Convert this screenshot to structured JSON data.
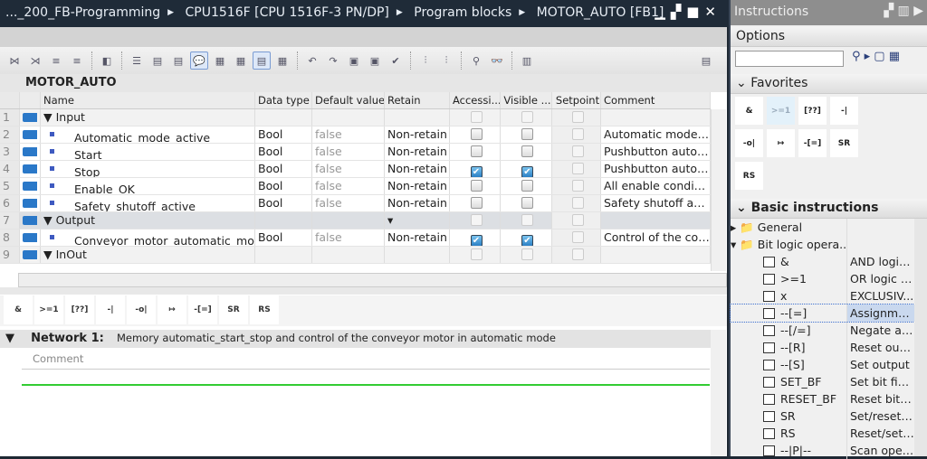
{
  "breadcrumb": [
    "..._200_FB-Programming",
    "CPU1516F [CPU 1516F-3 PN/DP]",
    "Program blocks",
    "MOTOR_AUTO [FB1]"
  ],
  "block_title": "MOTOR_AUTO",
  "columns": [
    "",
    "",
    "Name",
    "Data type",
    "Default value",
    "Retain",
    "Accessi...",
    "Visible ...",
    "Setpoint",
    "Comment"
  ],
  "rows": [
    {
      "n": "1",
      "name": "Input",
      "group": true,
      "type": "",
      "def": "",
      "retain": "",
      "acc": null,
      "vis": null,
      "comment": ""
    },
    {
      "n": "2",
      "name": "Automatic_mode_active",
      "type": "Bool",
      "def": "false",
      "retain": "Non-retain",
      "acc": false,
      "vis": false,
      "comment": "Automatic mode a..."
    },
    {
      "n": "3",
      "name": "Start",
      "type": "Bool",
      "def": "false",
      "retain": "Non-retain",
      "acc": false,
      "vis": false,
      "comment": "Pushbutton autom..."
    },
    {
      "n": "4",
      "name": "Stop",
      "type": "Bool",
      "def": "false",
      "retain": "Non-retain",
      "acc": true,
      "vis": true,
      "comment": "Pushbutton autom..."
    },
    {
      "n": "5",
      "name": "Enable_OK",
      "type": "Bool",
      "def": "false",
      "retain": "Non-retain",
      "acc": false,
      "vis": false,
      "comment": "All enable conditio..."
    },
    {
      "n": "6",
      "name": "Safety_shutoff_active",
      "type": "Bool",
      "def": "false",
      "retain": "Non-retain",
      "acc": false,
      "vis": false,
      "comment": "Safety shutoff activ..."
    },
    {
      "n": "7",
      "name": "Output",
      "group": true,
      "selected": true,
      "type": "",
      "def": "",
      "retain": "",
      "acc": null,
      "vis": null,
      "comment": ""
    },
    {
      "n": "8",
      "name": "Conveyor_motor_automatic_mode",
      "type": "Bool",
      "def": "false",
      "retain": "Non-retain",
      "acc": true,
      "vis": true,
      "comment": "Control of the conv..."
    },
    {
      "n": "9",
      "name": "InOut",
      "group": true,
      "type": "",
      "def": "",
      "retain": "",
      "acc": null,
      "vis": null,
      "comment": ""
    }
  ],
  "favorites": [
    "&",
    ">=1",
    "[??]",
    "-|",
    "-o|",
    "↦",
    "-[=]",
    "SR",
    "RS"
  ],
  "network": {
    "label": "Network 1:",
    "title": "Memory automatic_start_stop and control of the conveyor motor in automatic mode",
    "comment_placeholder": "Comment"
  },
  "panel": {
    "title": "Instructions",
    "options": "Options",
    "favorites": "Favorites",
    "basic": "Basic instructions",
    "tree": [
      {
        "name": "General",
        "kind": "folder",
        "desc": ""
      },
      {
        "name": "Bit logic opera...",
        "kind": "folder-open",
        "desc": ""
      },
      {
        "name": "&",
        "desc": "AND logic..."
      },
      {
        "name": ">=1",
        "desc": "OR logic o..."
      },
      {
        "name": "x",
        "desc": "EXCLUSIV..."
      },
      {
        "name": "--[=]",
        "desc": "Assignme...",
        "selected": true
      },
      {
        "name": "--[/=]",
        "desc": "Negate as..."
      },
      {
        "name": "--[R]",
        "desc": "Reset outp..."
      },
      {
        "name": "--[S]",
        "desc": "Set output"
      },
      {
        "name": "SET_BF",
        "desc": "Set bit field"
      },
      {
        "name": "RESET_BF",
        "desc": "Reset bit fi..."
      },
      {
        "name": "SR",
        "desc": "Set/reset fl..."
      },
      {
        "name": "RS",
        "desc": "Reset/set fl..."
      },
      {
        "name": "--|P|--",
        "desc": "Scan oper..."
      }
    ]
  }
}
